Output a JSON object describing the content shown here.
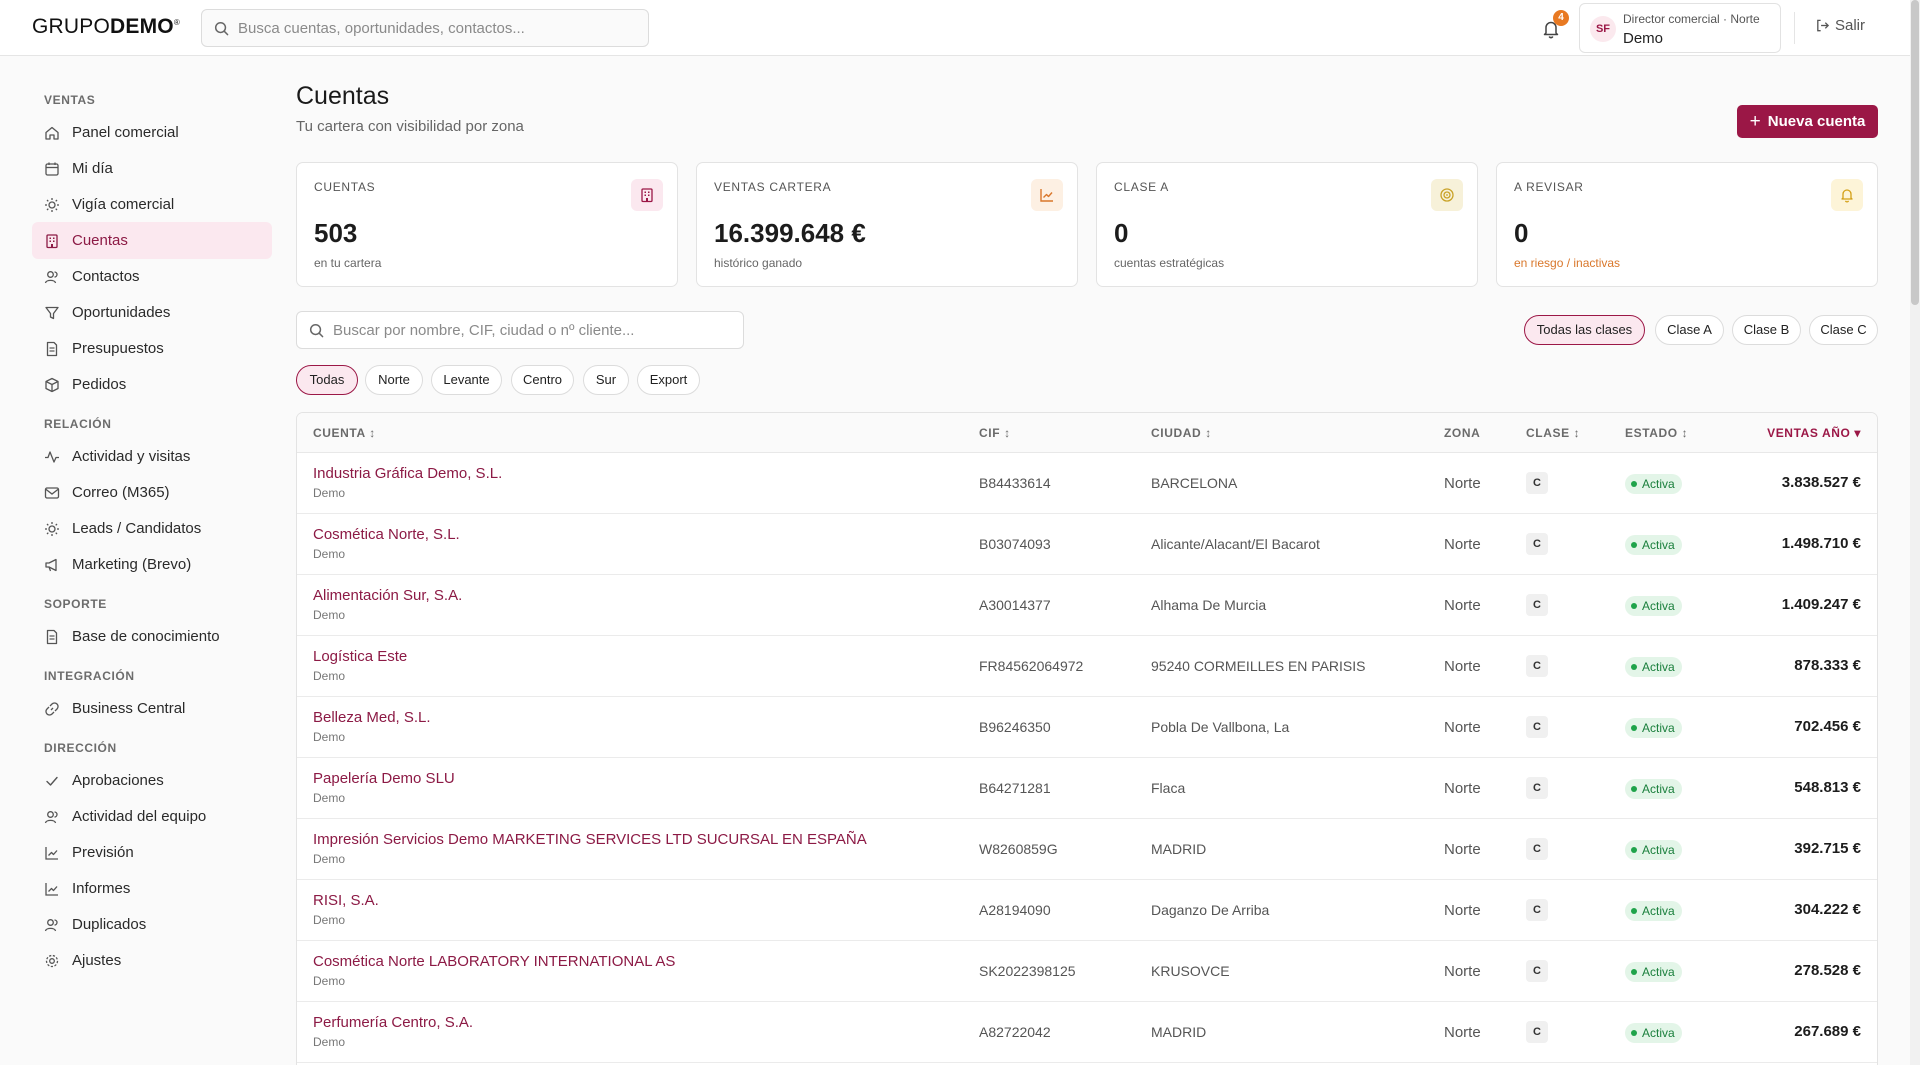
{
  "brand": {
    "logo_light": "GRUPO",
    "logo_bold": "DEMO",
    "logo_mark": "®"
  },
  "topbar": {
    "search_placeholder": "Busca cuentas, oportunidades, contactos...",
    "notifications_count": "4",
    "user_initials": "SF",
    "user_role": "Director comercial · Norte",
    "user_name": "Demo",
    "logout_label": "Salir"
  },
  "sidebar": {
    "sections": [
      {
        "title": "VENTAS",
        "items": [
          {
            "label": "Panel comercial",
            "icon": "home-icon"
          },
          {
            "label": "Mi día",
            "icon": "calendar-icon"
          },
          {
            "label": "Vigía comercial",
            "icon": "sun-icon"
          },
          {
            "label": "Cuentas",
            "icon": "building-icon",
            "active": true
          },
          {
            "label": "Contactos",
            "icon": "contacts-icon"
          },
          {
            "label": "Oportunidades",
            "icon": "funnel-icon"
          },
          {
            "label": "Presupuestos",
            "icon": "document-icon"
          },
          {
            "label": "Pedidos",
            "icon": "package-icon"
          }
        ]
      },
      {
        "title": "RELACIÓN",
        "items": [
          {
            "label": "Actividad y visitas",
            "icon": "activity-icon"
          },
          {
            "label": "Correo (M365)",
            "icon": "mail-icon"
          },
          {
            "label": "Leads / Candidatos",
            "icon": "sun-icon"
          },
          {
            "label": "Marketing (Brevo)",
            "icon": "megaphone-icon"
          }
        ]
      },
      {
        "title": "SOPORTE",
        "items": [
          {
            "label": "Base de conocimiento",
            "icon": "document-icon"
          }
        ]
      },
      {
        "title": "INTEGRACIÓN",
        "items": [
          {
            "label": "Business Central",
            "icon": "link-icon"
          }
        ]
      },
      {
        "title": "DIRECCIÓN",
        "items": [
          {
            "label": "Aprobaciones",
            "icon": "check-icon"
          },
          {
            "label": "Actividad del equipo",
            "icon": "contacts-icon"
          },
          {
            "label": "Previsión",
            "icon": "chart-line-icon"
          },
          {
            "label": "Informes",
            "icon": "chart-line-icon"
          },
          {
            "label": "Duplicados",
            "icon": "contacts-icon"
          },
          {
            "label": "Ajustes",
            "icon": "gear-icon"
          }
        ]
      }
    ]
  },
  "page": {
    "title": "Cuentas",
    "subtitle": "Tu cartera con visibilidad por zona",
    "new_button": "Nueva cuenta"
  },
  "kpis": [
    {
      "title": "CUENTAS",
      "value": "503",
      "sub": "en tu cartera",
      "icon": "building-icon",
      "icon_bg": "#fbe8ef",
      "icon_color": "#9b1746",
      "sub_color": "#666666"
    },
    {
      "title": "VENTAS CARTERA",
      "value": "16.399.648 €",
      "sub": "histórico ganado",
      "icon": "chart-line-icon",
      "icon_bg": "#fdf0e3",
      "icon_color": "#d9772b",
      "sub_color": "#666666"
    },
    {
      "title": "CLASE A",
      "value": "0",
      "sub": "cuentas estratégicas",
      "icon": "target-icon",
      "icon_bg": "#f7f1d9",
      "icon_color": "#c9a227",
      "sub_color": "#666666"
    },
    {
      "title": "A REVISAR",
      "value": "0",
      "sub": "en riesgo / inactivas",
      "icon": "bell-icon",
      "icon_bg": "#fdf4d8",
      "icon_color": "#d4a017",
      "sub_color": "#d9772b"
    }
  ],
  "filters": {
    "search_placeholder": "Buscar por nombre, CIF, ciudad o nº cliente...",
    "zones": [
      "Todas",
      "Norte",
      "Levante",
      "Centro",
      "Sur",
      "Export"
    ],
    "zone_selected": "Todas",
    "classes": [
      "Todas las clases",
      "Clase A",
      "Clase B",
      "Clase C"
    ],
    "class_selected": "Todas las clases"
  },
  "table": {
    "headers": {
      "cuenta": "CUENTA ↕",
      "cif": "CIF ↕",
      "ciudad": "CIUDAD ↕",
      "zona": "ZONA",
      "clase": "CLASE ↕",
      "estado": "ESTADO ↕",
      "ventas": "VENTAS AÑO ▾"
    },
    "rows": [
      {
        "name": "Industria Gráfica Demo, S.L.",
        "sub": "Demo",
        "cif": "B84433614",
        "city": "BARCELONA",
        "zone": "Norte",
        "class": "C",
        "state": "Activa",
        "sales": "3.838.527 €"
      },
      {
        "name": "Cosmética Norte, S.L.",
        "sub": "Demo",
        "cif": "B03074093",
        "city": "Alicante/Alacant/El Bacarot",
        "zone": "Norte",
        "class": "C",
        "state": "Activa",
        "sales": "1.498.710 €"
      },
      {
        "name": "Alimentación Sur, S.A.",
        "sub": "Demo",
        "cif": "A30014377",
        "city": "Alhama De Murcia",
        "zone": "Norte",
        "class": "C",
        "state": "Activa",
        "sales": "1.409.247 €"
      },
      {
        "name": "Logística Este",
        "sub": "Demo",
        "cif": "FR84562064972",
        "city": "95240 CORMEILLES EN PARISIS",
        "zone": "Norte",
        "class": "C",
        "state": "Activa",
        "sales": "878.333 €"
      },
      {
        "name": "Belleza Med, S.L.",
        "sub": "Demo",
        "cif": "B96246350",
        "city": "Pobla De Vallbona, La",
        "zone": "Norte",
        "class": "C",
        "state": "Activa",
        "sales": "702.456 €"
      },
      {
        "name": "Papelería Demo SLU",
        "sub": "Demo",
        "cif": "B64271281",
        "city": "Flaca",
        "zone": "Norte",
        "class": "C",
        "state": "Activa",
        "sales": "548.813 €"
      },
      {
        "name": "Impresión Servicios Demo MARKETING SERVICES LTD SUCURSAL EN ESPAÑA",
        "sub": "Demo",
        "cif": "W8260859G",
        "city": "MADRID",
        "zone": "Norte",
        "class": "C",
        "state": "Activa",
        "sales": "392.715 €"
      },
      {
        "name": "RISI, S.A.",
        "sub": "Demo",
        "cif": "A28194090",
        "city": "Daganzo De Arriba",
        "zone": "Norte",
        "class": "C",
        "state": "Activa",
        "sales": "304.222 €"
      },
      {
        "name": "Cosmética Norte LABORATORY INTERNATIONAL AS",
        "sub": "Demo",
        "cif": "SK2022398125",
        "city": "KRUSOVCE",
        "zone": "Norte",
        "class": "C",
        "state": "Activa",
        "sales": "278.528 €"
      },
      {
        "name": "Perfumería Centro, S.A.",
        "sub": "Demo",
        "cif": "A82722042",
        "city": "MADRID",
        "zone": "Norte",
        "class": "C",
        "state": "Activa",
        "sales": "267.689 €"
      }
    ]
  }
}
